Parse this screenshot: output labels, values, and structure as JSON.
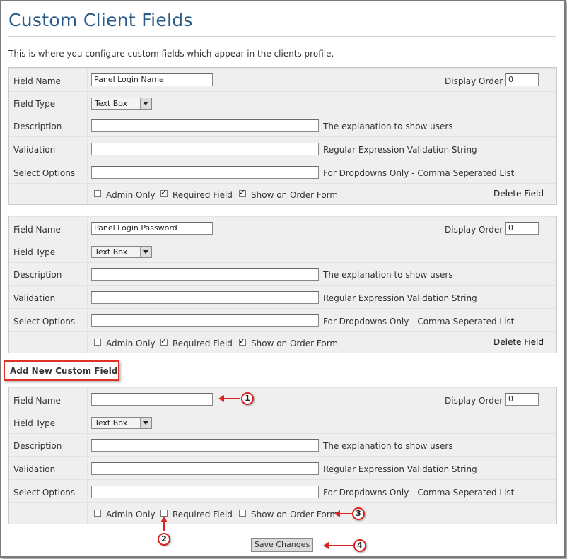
{
  "page": {
    "title": "Custom Client Fields",
    "intro": "This is where you configure custom fields which appear in the clients profile."
  },
  "labels": {
    "field_name": "Field Name",
    "field_type": "Field Type",
    "description": "Description",
    "validation": "Validation",
    "select_options": "Select Options",
    "display_order": "Display Order",
    "description_hint": "The explanation to show users",
    "validation_hint": "Regular Expression Validation String",
    "options_hint": "For Dropdowns Only - Comma Seperated List",
    "admin_only": "Admin Only",
    "required_field": "Required Field",
    "show_on_order_form": "Show on Order Form",
    "delete_field": "Delete Field"
  },
  "fields": [
    {
      "name": "Panel Login Name",
      "type": "Text Box",
      "display_order": "0",
      "description": "",
      "validation": "",
      "options": "",
      "admin_only": false,
      "required": true,
      "show_on_order_form": true
    },
    {
      "name": "Panel Login Password",
      "type": "Text Box",
      "display_order": "0",
      "description": "",
      "validation": "",
      "options": "",
      "admin_only": false,
      "required": true,
      "show_on_order_form": true
    }
  ],
  "new_field": {
    "heading": "Add New Custom Field",
    "name": "",
    "type": "Text Box",
    "display_order": "0",
    "description": "",
    "validation": "",
    "options": "",
    "admin_only": false,
    "required": false,
    "show_on_order_form": false
  },
  "save_button": "Save Changes",
  "callouts": [
    "1",
    "2",
    "3",
    "4"
  ],
  "colors": {
    "title": "#2a5a88",
    "callout": "#dd2222",
    "highlight_box": "#e0322b"
  }
}
